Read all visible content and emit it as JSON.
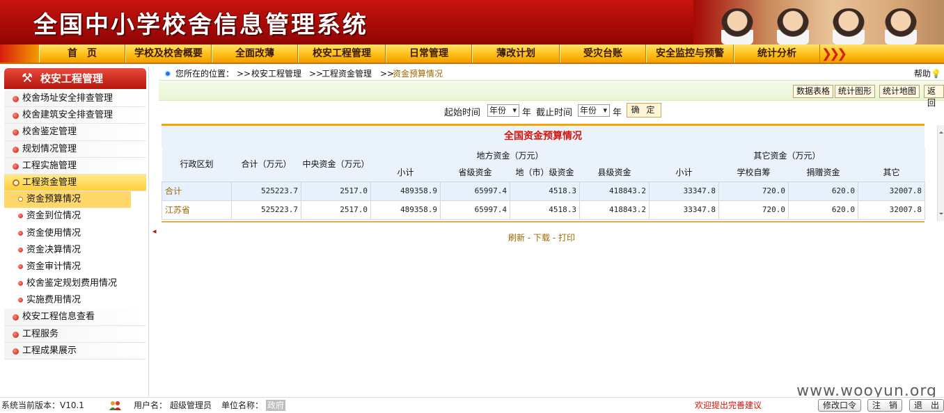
{
  "header": {
    "title": "全国中小学校舍信息管理系统"
  },
  "nav": {
    "items": [
      "首　页",
      "学校及校舍概要",
      "全面改薄",
      "校安工程管理",
      "日常管理",
      "薄改计划",
      "受灾台账",
      "安全监控与预警",
      "统计分析"
    ]
  },
  "sidebar": {
    "title": "校安工程管理",
    "items": [
      {
        "label": "校舍场址安全排查管理",
        "kind": "top"
      },
      {
        "label": "校舍建筑安全排查管理",
        "kind": "top"
      },
      {
        "label": "校舍鉴定管理",
        "kind": "top"
      },
      {
        "label": "规划情况管理",
        "kind": "top"
      },
      {
        "label": "工程实施管理",
        "kind": "top"
      },
      {
        "label": "工程资金管理",
        "kind": "open"
      },
      {
        "label": "资金预算情况",
        "kind": "sub-active"
      },
      {
        "label": "资金到位情况",
        "kind": "sub"
      },
      {
        "label": "资金使用情况",
        "kind": "sub"
      },
      {
        "label": "资金决算情况",
        "kind": "sub"
      },
      {
        "label": "资金审计情况",
        "kind": "sub"
      },
      {
        "label": "校舍鉴定规划费用情况",
        "kind": "sub"
      },
      {
        "label": "实施费用情况",
        "kind": "sub"
      },
      {
        "label": "校安工程信息查看",
        "kind": "top"
      },
      {
        "label": "工程服务",
        "kind": "top"
      },
      {
        "label": "工程成果展示",
        "kind": "top"
      }
    ]
  },
  "breadcrumb": {
    "prefix": "您所在的位置：",
    "parts": [
      "工程资金管理",
      "资金预算情况"
    ],
    "first": "校安工程管理",
    "help": "帮助"
  },
  "toolbar": {
    "buttons": [
      "数据表格",
      "统计图形",
      "统计地图",
      "返 回"
    ]
  },
  "filter": {
    "start_label": "起始时间",
    "start_value": "年份",
    "year1": "年",
    "end_label": "截止时间",
    "end_value": "年份",
    "year2": "年",
    "confirm": "确 定"
  },
  "table": {
    "title": "全国资金预算情况",
    "h_region": "行政区划",
    "h_total": "合计（万元）",
    "h_central": "中央资金（万元）",
    "h_local": "地方资金（万元）",
    "h_other": "其它资金（万元）",
    "h_local_sub": [
      "小计",
      "省级资金",
      "地（市）级资金",
      "县级资金"
    ],
    "h_other_sub": [
      "小计",
      "学校自筹",
      "捐赠资金",
      "其它"
    ],
    "rows": [
      {
        "region": "合计",
        "values": [
          "525223.7",
          "2517.0",
          "489358.9",
          "65997.4",
          "4518.3",
          "418843.2",
          "33347.8",
          "720.0",
          "620.0",
          "32007.8"
        ]
      },
      {
        "region": "江苏省",
        "values": [
          "525223.7",
          "2517.0",
          "489358.9",
          "65997.4",
          "4518.3",
          "418843.2",
          "33347.8",
          "720.0",
          "620.0",
          "32007.8"
        ]
      }
    ]
  },
  "links": {
    "refresh": "刷新",
    "download": "下载",
    "print": "打印",
    "sep": " - "
  },
  "watermark": "www.wooyun.org",
  "footer": {
    "version": "系统当前版本：V10.1",
    "user_label": "用户名：",
    "user_value": "超级管理员",
    "unit_label": "单位名称：",
    "unit_value": "政府",
    "suggest": "欢迎提出完善建议",
    "buttons": [
      "修改口令",
      "注　销",
      "退　出"
    ]
  }
}
